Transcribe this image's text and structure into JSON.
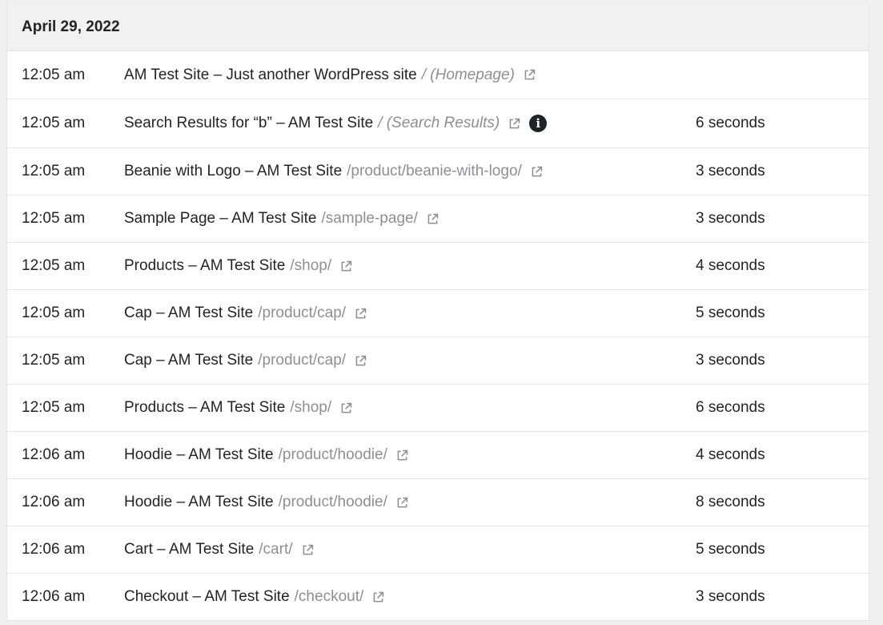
{
  "date_header": "April 29, 2022",
  "rows": [
    {
      "time": "12:05 am",
      "title": "AM Test Site – Just another WordPress site",
      "path": "/ (Homepage)",
      "duration": ""
    },
    {
      "time": "12:05 am",
      "title": "Search Results for “b” – AM Test Site",
      "path": "/ (Search Results)",
      "duration": "6 seconds",
      "has_info": true
    },
    {
      "time": "12:05 am",
      "title": "Beanie with Logo – AM Test Site",
      "path": "/product/beanie-with-logo/",
      "duration": "3 seconds"
    },
    {
      "time": "12:05 am",
      "title": "Sample Page – AM Test Site",
      "path": "/sample-page/",
      "duration": "3 seconds"
    },
    {
      "time": "12:05 am",
      "title": "Products – AM Test Site",
      "path": "/shop/",
      "duration": "4 seconds"
    },
    {
      "time": "12:05 am",
      "title": "Cap – AM Test Site",
      "path": "/product/cap/",
      "duration": "5 seconds"
    },
    {
      "time": "12:05 am",
      "title": "Cap – AM Test Site",
      "path": "/product/cap/",
      "duration": "3 seconds"
    },
    {
      "time": "12:05 am",
      "title": "Products – AM Test Site",
      "path": "/shop/",
      "duration": "6 seconds"
    },
    {
      "time": "12:06 am",
      "title": "Hoodie – AM Test Site",
      "path": "/product/hoodie/",
      "duration": "4 seconds"
    },
    {
      "time": "12:06 am",
      "title": "Hoodie – AM Test Site",
      "path": "/product/hoodie/",
      "duration": "8 seconds"
    },
    {
      "time": "12:06 am",
      "title": "Cart – AM Test Site",
      "path": "/cart/",
      "duration": "5 seconds"
    },
    {
      "time": "12:06 am",
      "title": "Checkout – AM Test Site",
      "path": "/checkout/",
      "duration": "3 seconds"
    }
  ],
  "icons": {
    "external_link": "external-link-icon",
    "info": "info-icon"
  },
  "colors": {
    "text": "#1d2327",
    "path": "#8c8f94",
    "header_bg": "#f1f1f1"
  }
}
